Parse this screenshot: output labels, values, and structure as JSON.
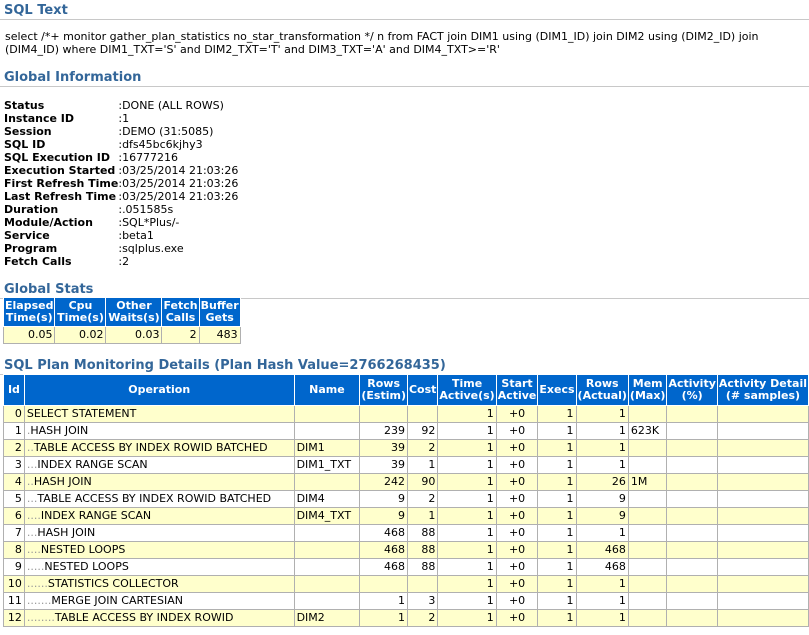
{
  "sections": {
    "sql_text": "SQL Text",
    "global_information": "Global Information",
    "global_stats": "Global Stats",
    "plan_details": "SQL Plan Monitoring Details (Plan Hash Value=2766268435)"
  },
  "sql_text": "select /*+ monitor gather_plan_statistics no_star_transformation */ n from FACT join DIM1 using (DIM1_ID) join DIM2 using (DIM2_ID) join (DIM4_ID) where DIM1_TXT='S' and DIM2_TXT='T' and DIM3_TXT='A' and DIM4_TXT>='R'",
  "global_info": [
    {
      "key": "Status",
      "value": ":DONE (ALL ROWS)"
    },
    {
      "key": "Instance ID",
      "value": ":1"
    },
    {
      "key": "Session",
      "value": ":DEMO (31:5085)"
    },
    {
      "key": "SQL ID",
      "value": ":dfs45bc6kjhy3"
    },
    {
      "key": "SQL Execution ID",
      "value": ":16777216"
    },
    {
      "key": "Execution Started",
      "value": ":03/25/2014 21:03:26"
    },
    {
      "key": "First Refresh Time",
      "value": ":03/25/2014 21:03:26"
    },
    {
      "key": "Last Refresh Time",
      "value": ":03/25/2014 21:03:26"
    },
    {
      "key": "Duration",
      "value": ":.051585s"
    },
    {
      "key": "Module/Action",
      "value": ":SQL*Plus/-"
    },
    {
      "key": "Service",
      "value": ":beta1"
    },
    {
      "key": "Program",
      "value": ":sqlplus.exe"
    },
    {
      "key": "Fetch Calls",
      "value": ":2"
    }
  ],
  "global_stats": {
    "headers": [
      [
        "Elapsed",
        "Time(s)"
      ],
      [
        "Cpu",
        "Time(s)"
      ],
      [
        "Other",
        "Waits(s)"
      ],
      [
        "Fetch",
        "Calls"
      ],
      [
        "Buffer",
        "Gets"
      ]
    ],
    "values": [
      "0.05",
      "0.02",
      "0.03",
      "2",
      "483"
    ]
  },
  "plan": {
    "headers": [
      [
        "Id"
      ],
      [
        "Operation"
      ],
      [
        "Name"
      ],
      [
        "Rows",
        "(Estim)"
      ],
      [
        "Cost"
      ],
      [
        "Time",
        "Active(s)"
      ],
      [
        "Start",
        "Active"
      ],
      [
        "Execs"
      ],
      [
        "Rows",
        "(Actual)"
      ],
      [
        "Mem",
        "(Max)"
      ],
      [
        "Activity",
        "(%)"
      ],
      [
        "Activity Detail",
        "(# samples)"
      ]
    ],
    "rows": [
      {
        "id": "0",
        "dots": "",
        "op": "SELECT STATEMENT",
        "name": "",
        "rows_est": "",
        "cost": "",
        "time_active": "1",
        "start_active": "+0",
        "execs": "1",
        "rows_act": "1",
        "mem": "",
        "activity": "",
        "detail": ""
      },
      {
        "id": "1",
        "dots": ".",
        "op": "HASH JOIN",
        "name": "",
        "rows_est": "239",
        "cost": "92",
        "time_active": "1",
        "start_active": "+0",
        "execs": "1",
        "rows_act": "1",
        "mem": "623K",
        "activity": "",
        "detail": ""
      },
      {
        "id": "2",
        "dots": "..",
        "op": "TABLE ACCESS BY INDEX ROWID BATCHED",
        "name": "DIM1",
        "rows_est": "39",
        "cost": "2",
        "time_active": "1",
        "start_active": "+0",
        "execs": "1",
        "rows_act": "1",
        "mem": "",
        "activity": "",
        "detail": ""
      },
      {
        "id": "3",
        "dots": "...",
        "op": "INDEX RANGE SCAN",
        "name": "DIM1_TXT",
        "rows_est": "39",
        "cost": "1",
        "time_active": "1",
        "start_active": "+0",
        "execs": "1",
        "rows_act": "1",
        "mem": "",
        "activity": "",
        "detail": ""
      },
      {
        "id": "4",
        "dots": "..",
        "op": "HASH JOIN",
        "name": "",
        "rows_est": "242",
        "cost": "90",
        "time_active": "1",
        "start_active": "+0",
        "execs": "1",
        "rows_act": "26",
        "mem": "1M",
        "activity": "",
        "detail": ""
      },
      {
        "id": "5",
        "dots": "...",
        "op": "TABLE ACCESS BY INDEX ROWID BATCHED",
        "name": "DIM4",
        "rows_est": "9",
        "cost": "2",
        "time_active": "1",
        "start_active": "+0",
        "execs": "1",
        "rows_act": "9",
        "mem": "",
        "activity": "",
        "detail": ""
      },
      {
        "id": "6",
        "dots": "....",
        "op": "INDEX RANGE SCAN",
        "name": "DIM4_TXT",
        "rows_est": "9",
        "cost": "1",
        "time_active": "1",
        "start_active": "+0",
        "execs": "1",
        "rows_act": "9",
        "mem": "",
        "activity": "",
        "detail": ""
      },
      {
        "id": "7",
        "dots": "...",
        "op": "HASH JOIN",
        "name": "",
        "rows_est": "468",
        "cost": "88",
        "time_active": "1",
        "start_active": "+0",
        "execs": "1",
        "rows_act": "1",
        "mem": "",
        "activity": "",
        "detail": ""
      },
      {
        "id": "8",
        "dots": "....",
        "op": "NESTED LOOPS",
        "name": "",
        "rows_est": "468",
        "cost": "88",
        "time_active": "1",
        "start_active": "+0",
        "execs": "1",
        "rows_act": "468",
        "mem": "",
        "activity": "",
        "detail": ""
      },
      {
        "id": "9",
        "dots": ".....",
        "op": "NESTED LOOPS",
        "name": "",
        "rows_est": "468",
        "cost": "88",
        "time_active": "1",
        "start_active": "+0",
        "execs": "1",
        "rows_act": "468",
        "mem": "",
        "activity": "",
        "detail": ""
      },
      {
        "id": "10",
        "dots": "......",
        "op": "STATISTICS COLLECTOR",
        "name": "",
        "rows_est": "",
        "cost": "",
        "time_active": "1",
        "start_active": "+0",
        "execs": "1",
        "rows_act": "1",
        "mem": "",
        "activity": "",
        "detail": ""
      },
      {
        "id": "11",
        "dots": ".......",
        "op": "MERGE JOIN CARTESIAN",
        "name": "",
        "rows_est": "1",
        "cost": "3",
        "time_active": "1",
        "start_active": "+0",
        "execs": "1",
        "rows_act": "1",
        "mem": "",
        "activity": "",
        "detail": ""
      },
      {
        "id": "12",
        "dots": "........",
        "op": "TABLE ACCESS BY INDEX ROWID",
        "name": "DIM2",
        "rows_est": "1",
        "cost": "2",
        "time_active": "1",
        "start_active": "+0",
        "execs": "1",
        "rows_act": "1",
        "mem": "",
        "activity": "",
        "detail": ""
      }
    ]
  }
}
